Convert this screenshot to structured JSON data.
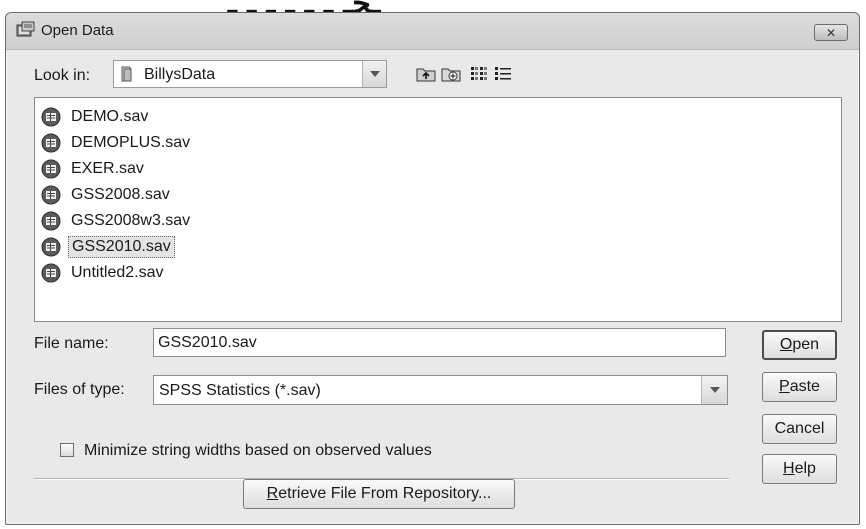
{
  "window": {
    "title": "Open Data",
    "close_glyph": "✕"
  },
  "look_in": {
    "label": "Look in:",
    "value": "BillysData"
  },
  "toolbar": {
    "icons": [
      "up-folder-icon",
      "new-folder-icon",
      "list-view-icon",
      "details-view-icon"
    ]
  },
  "files": [
    {
      "name": "DEMO.sav",
      "selected": false
    },
    {
      "name": "DEMOPLUS.sav",
      "selected": false
    },
    {
      "name": "EXER.sav",
      "selected": false
    },
    {
      "name": "GSS2008.sav",
      "selected": false
    },
    {
      "name": "GSS2008w3.sav",
      "selected": false
    },
    {
      "name": "GSS2010.sav",
      "selected": true
    },
    {
      "name": "Untitled2.sav",
      "selected": false
    }
  ],
  "file_name": {
    "label": "File name:",
    "value": "GSS2010.sav"
  },
  "files_of_type": {
    "label": "Files of type:",
    "value": "SPSS Statistics (*.sav)"
  },
  "minimize_option": {
    "label": "Minimize string widths based on observed values",
    "checked": false
  },
  "buttons": {
    "open": {
      "underline": "O",
      "rest": "pen"
    },
    "paste": {
      "underline": "P",
      "rest": "aste"
    },
    "cancel": {
      "label": "Cancel"
    },
    "help": {
      "underline": "H",
      "rest": "elp"
    },
    "retrieve": {
      "underline": "R",
      "rest": "etrieve File From Repository..."
    }
  }
}
